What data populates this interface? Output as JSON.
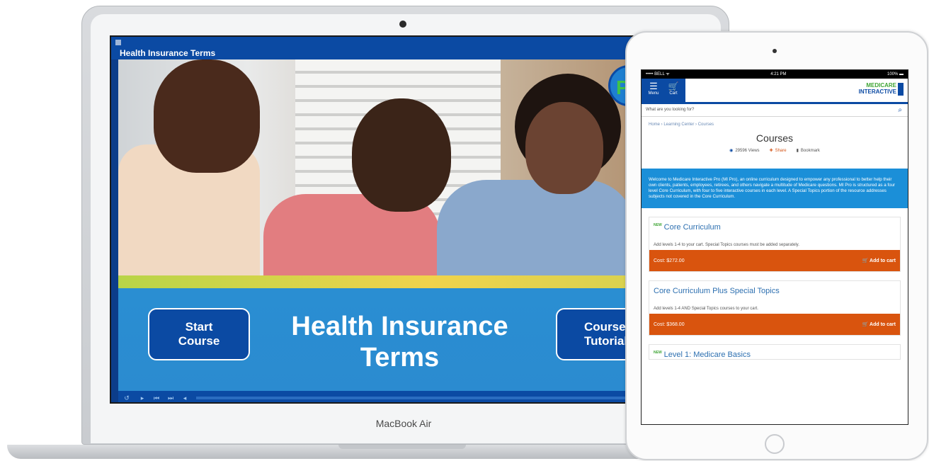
{
  "laptop": {
    "brand": "MacBook Air",
    "player": {
      "title": "Health Insurance Terms",
      "course_title": "Health Insurance\nTerms",
      "start_button": "Start\nCourse",
      "tutorial_button": "Course\nTutorial",
      "badge_text": "P"
    }
  },
  "tablet": {
    "status": {
      "left": "••••• BELL ᯤ",
      "center": "4:21 PM",
      "right": "100% ▬"
    },
    "header": {
      "menu_label": "Menu",
      "cart_label": "Cart",
      "logo_line1": "MEDICARE",
      "logo_line2": "INTERACTIVE"
    },
    "search": {
      "placeholder": "What are you looking for?"
    },
    "breadcrumb": "Home › Learning Center › Courses",
    "page_title": "Courses",
    "meta": {
      "views": "29596 Views",
      "share": "Share",
      "bookmark": "Bookmark"
    },
    "intro": "Welcome to Medicare Interactive Pro (MI Pro), an online curriculum designed to empower any professional to better help their own clients, patients, employees, retirees, and others navigate a multitude of Medicare questions. MI Pro is structured as a four level Core Curriculum, with four to five interactive courses in each level. A Special Topics portion of the resource addresses subjects not covered in the Core Curriculum.",
    "courses": [
      {
        "new": "NEW",
        "title": "Core Curriculum",
        "desc": "Add levels 1-4 to your cart. Special Topics courses must be added separately.",
        "cost": "Cost: $272.00",
        "cart": "Add to cart"
      },
      {
        "new": "",
        "title": "Core Curriculum Plus Special Topics",
        "desc": "Add levels 1-4 AND Special Topics courses to your cart.",
        "cost": "Cost: $368.00",
        "cart": "Add to cart"
      },
      {
        "new": "NEW",
        "title": "Level 1: Medicare Basics",
        "desc": "",
        "cost": "",
        "cart": ""
      }
    ]
  },
  "colors": {
    "brand_blue": "#0b4aa3",
    "accent_orange": "#d9540e",
    "intro_blue": "#1b8fd8",
    "logo_green": "#3fa535"
  }
}
